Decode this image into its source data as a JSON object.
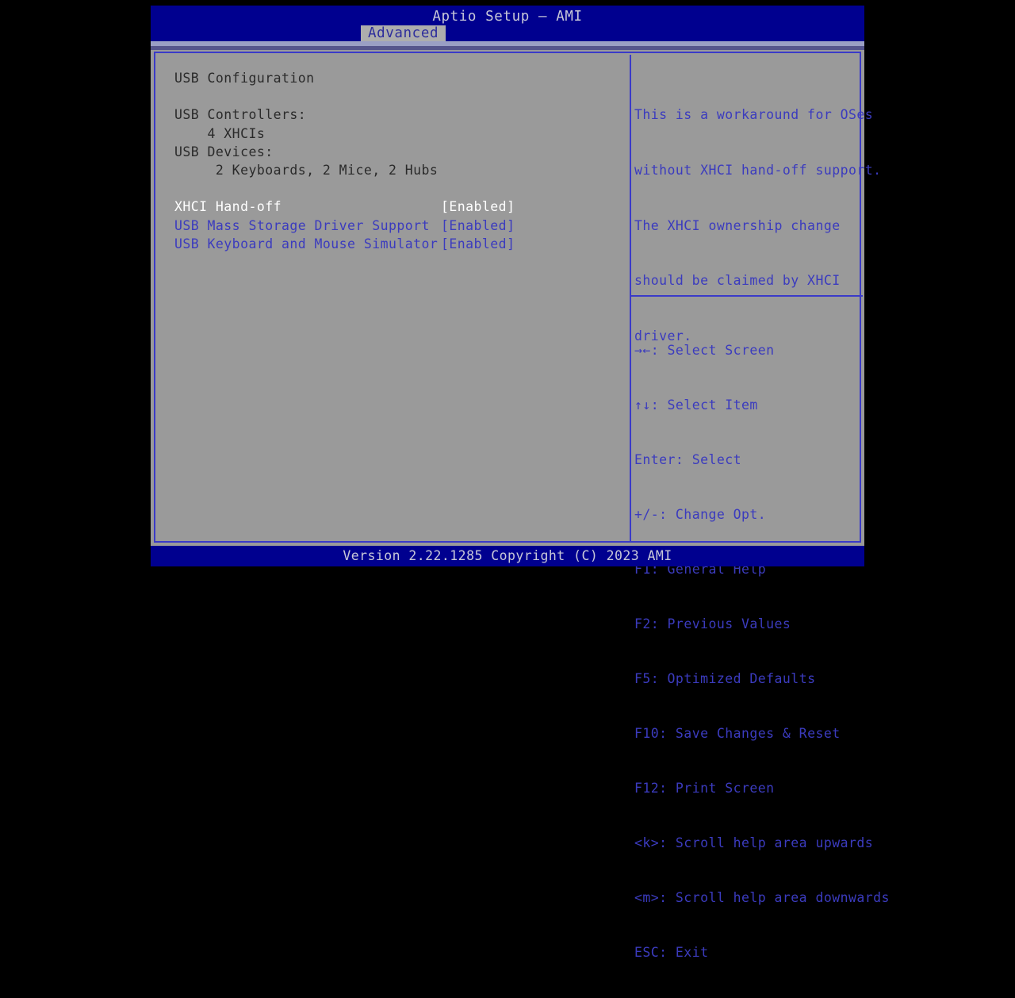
{
  "header": {
    "title": "Aptio Setup – AMI",
    "tabs": [
      {
        "label": "Advanced",
        "active": true
      }
    ]
  },
  "main": {
    "section_title": "USB Configuration",
    "info": [
      {
        "label": "USB Controllers:"
      },
      {
        "label": "    4 XHCIs"
      },
      {
        "label": "USB Devices:"
      },
      {
        "label": "     2 Keyboards, 2 Mice, 2 Hubs"
      }
    ],
    "settings": [
      {
        "label": "XHCI Hand-off",
        "value": "[Enabled]",
        "selected": true
      },
      {
        "label": "USB Mass Storage Driver Support",
        "value": "[Enabled]",
        "selected": false
      },
      {
        "label": "USB Keyboard and Mouse Simulator",
        "value": "[Enabled]",
        "selected": false
      }
    ]
  },
  "help": {
    "description_lines": [
      "This is a workaround for OSes",
      "without XHCI hand-off support.",
      "The XHCI ownership change",
      "should be claimed by XHCI",
      "driver."
    ],
    "keys": [
      {
        "key": "→←",
        "action": ": Select Screen"
      },
      {
        "key": "↑↓",
        "action": ": Select Item"
      },
      {
        "key": "Enter",
        "action": ": Select"
      },
      {
        "key": "+/-",
        "action": ": Change Opt."
      },
      {
        "key": "F1",
        "action": ": General Help"
      },
      {
        "key": "F2",
        "action": ": Previous Values"
      },
      {
        "key": "F5",
        "action": ": Optimized Defaults"
      },
      {
        "key": "F10",
        "action": ": Save Changes & Reset"
      },
      {
        "key": "F12",
        "action": ": Print Screen"
      },
      {
        "key": "<k>",
        "action": ": Scroll help area upwards"
      },
      {
        "key": "<m>",
        "action": ": Scroll help area downwards"
      },
      {
        "key": "ESC",
        "action": ": Exit"
      }
    ]
  },
  "footer": {
    "version_text": "Version 2.22.1285 Copyright (C) 2023 AMI"
  },
  "colors": {
    "title_bar": "#00008f",
    "panel_bg": "#9a9a9a",
    "text_blue": "#3b3bbe",
    "text_selected": "#ffffff",
    "border_blue": "#3a3ac8",
    "footer_text": "#c8c8d8"
  }
}
